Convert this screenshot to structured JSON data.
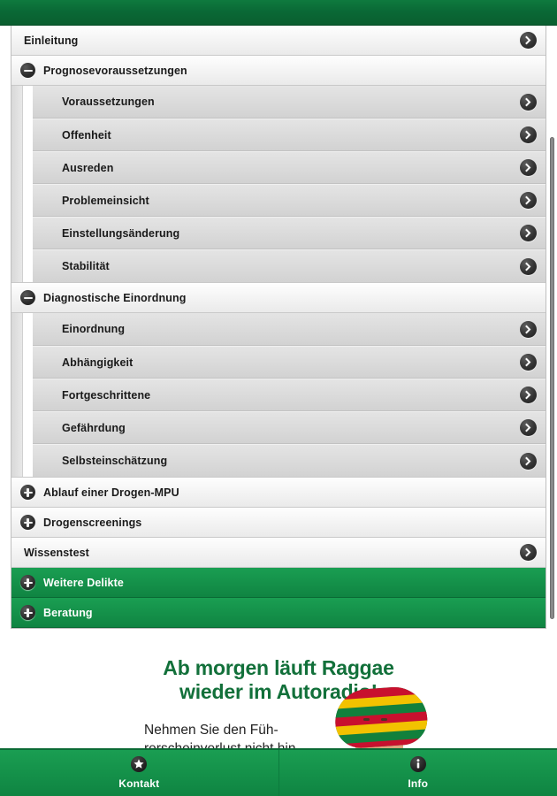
{
  "theme": {
    "brand_green": "#0a6936",
    "row_green": "#149049",
    "text_dark": "#1a1a1a",
    "ad_green": "#12703a"
  },
  "header": {
    "title": ""
  },
  "accordion": {
    "items": [
      {
        "label": "Einleitung",
        "level": 0,
        "toggle": null,
        "chevron": true,
        "style": "light"
      },
      {
        "label": "Prognosevoraussetzungen",
        "level": 0,
        "toggle": "minus",
        "chevron": false,
        "style": "light",
        "children": [
          {
            "label": "Voraussetzungen",
            "chevron": true
          },
          {
            "label": "Offenheit",
            "chevron": true
          },
          {
            "label": "Ausreden",
            "chevron": true
          },
          {
            "label": "Problemeinsicht",
            "chevron": true
          },
          {
            "label": "Einstellungsänderung",
            "chevron": true
          },
          {
            "label": "Stabilität",
            "chevron": true
          }
        ]
      },
      {
        "label": "Diagnostische Einordnung",
        "level": 0,
        "toggle": "minus",
        "chevron": false,
        "style": "light",
        "children": [
          {
            "label": "Einordnung",
            "chevron": true
          },
          {
            "label": "Abhängigkeit",
            "chevron": true
          },
          {
            "label": "Fortgeschrittene",
            "chevron": true
          },
          {
            "label": "Gefährdung",
            "chevron": true
          },
          {
            "label": "Selbsteinschätzung",
            "chevron": true
          }
        ]
      },
      {
        "label": "Ablauf einer Drogen-MPU",
        "level": 0,
        "toggle": "plus",
        "chevron": false,
        "style": "light"
      },
      {
        "label": "Drogenscreenings",
        "level": 0,
        "toggle": "plus",
        "chevron": false,
        "style": "light"
      },
      {
        "label": "Wissenstest",
        "level": 0,
        "toggle": null,
        "chevron": true,
        "style": "light"
      },
      {
        "label": "Weitere Delikte",
        "level": 0,
        "toggle": "plus",
        "chevron": false,
        "style": "green"
      },
      {
        "label": "Beratung",
        "level": 0,
        "toggle": "plus",
        "chevron": false,
        "style": "green"
      }
    ]
  },
  "ad": {
    "headline_line1": "Ab morgen läuft Raggae",
    "headline_line2": "wieder im Autoradio!",
    "body": "Nehmen Sie den Füh­rerscheinverlust nicht hin. Auch für Sie gibt es einen Weg zurück zum",
    "photo_alt": "man-with-rasta-cap-photo"
  },
  "tabbar": {
    "tabs": [
      {
        "label": "Kontakt",
        "icon": "star-icon"
      },
      {
        "label": "Info",
        "icon": "info-icon"
      }
    ]
  }
}
